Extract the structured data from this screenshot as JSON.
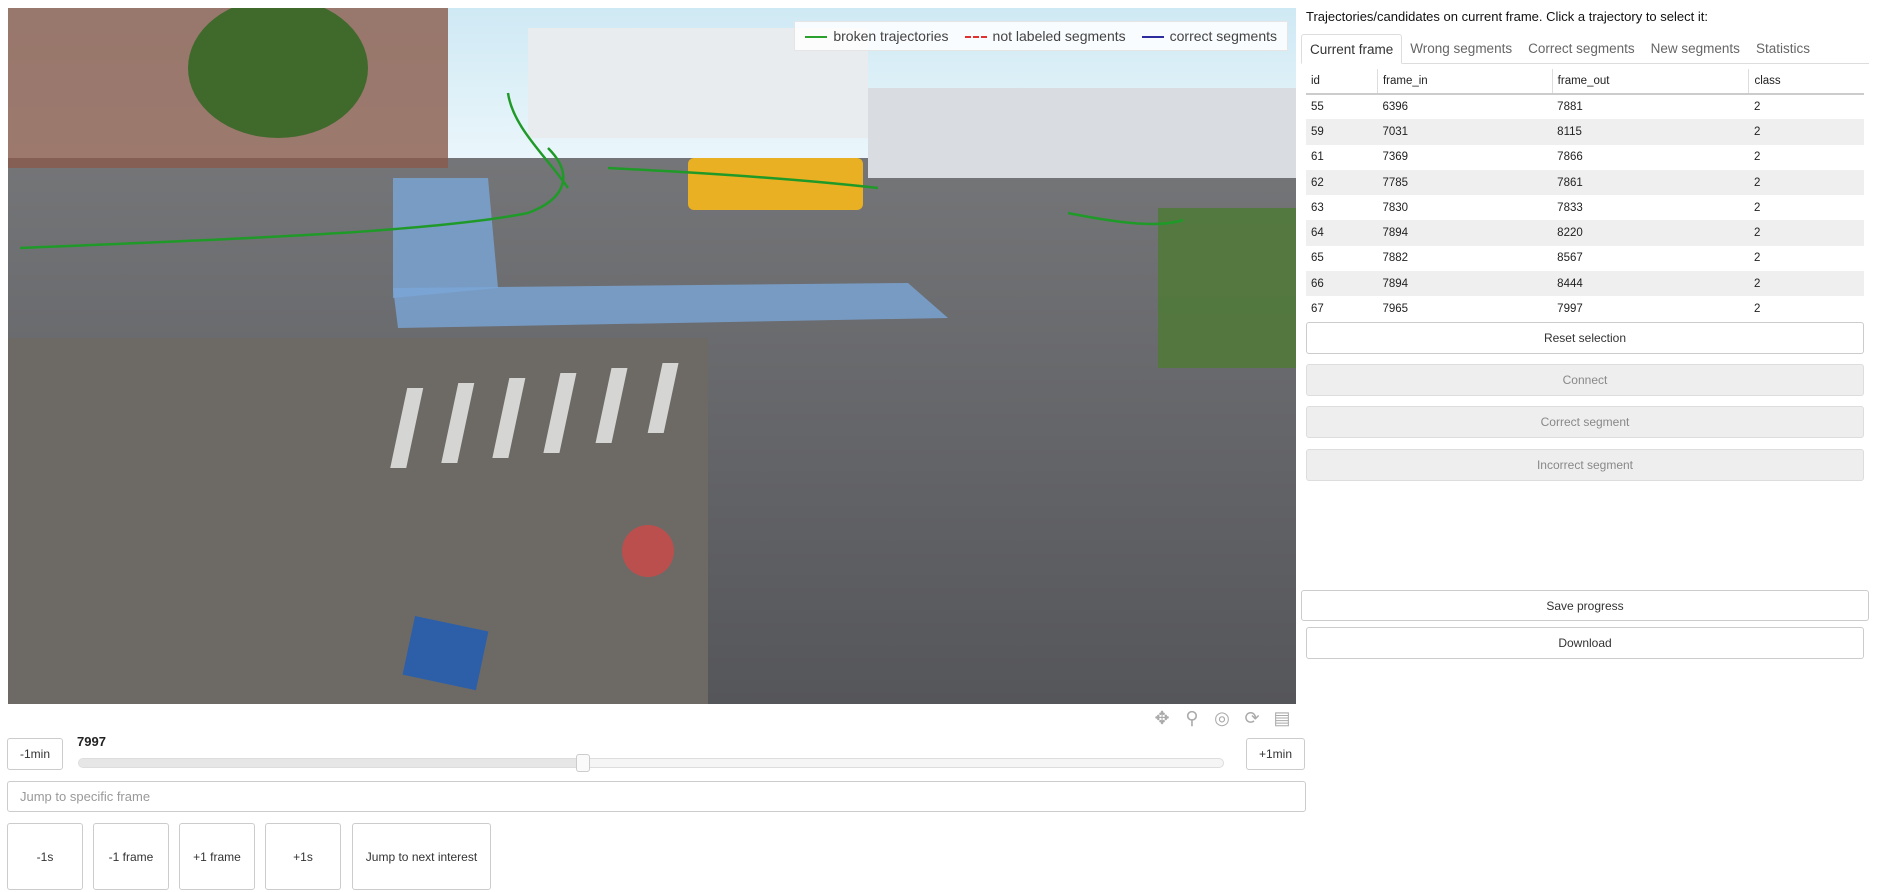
{
  "video": {
    "legend": [
      {
        "label": "broken trajectories",
        "color": "#2ca02c",
        "style": "solid"
      },
      {
        "label": "not labeled segments",
        "color": "#e03030",
        "style": "dashed"
      },
      {
        "label": "correct segments",
        "color": "#2c2c9c",
        "style": "solid"
      }
    ],
    "toolbar": [
      "pan-icon",
      "box-zoom-icon",
      "wheel-zoom-icon",
      "reset-icon",
      "hover-icon"
    ]
  },
  "controls": {
    "minus_min": "-1min",
    "plus_min": "+1min",
    "frame_value": "7997",
    "slider_fraction": 0.44,
    "jump_placeholder": "Jump to specific frame",
    "minus_1s": "-1s",
    "minus_frame": "-1 frame",
    "plus_frame": "+1 frame",
    "plus_1s": "+1s",
    "next_interest": "Jump to next interest"
  },
  "panel": {
    "title": "Trajectories/candidates on current frame. Click a trajectory to select it:",
    "tabs": [
      "Current frame",
      "Wrong segments",
      "Correct segments",
      "New segments",
      "Statistics"
    ],
    "columns": [
      "id",
      "frame_in",
      "frame_out",
      "class"
    ],
    "rows": [
      [
        "55",
        "6396",
        "7881",
        "2"
      ],
      [
        "59",
        "7031",
        "8115",
        "2"
      ],
      [
        "61",
        "7369",
        "7866",
        "2"
      ],
      [
        "62",
        "7785",
        "7861",
        "2"
      ],
      [
        "63",
        "7830",
        "7833",
        "2"
      ],
      [
        "64",
        "7894",
        "8220",
        "2"
      ],
      [
        "65",
        "7882",
        "8567",
        "2"
      ],
      [
        "66",
        "7894",
        "8444",
        "2"
      ],
      [
        "67",
        "7965",
        "7997",
        "2"
      ]
    ],
    "reset": "Reset selection",
    "connect": "Connect",
    "correct": "Correct segment",
    "incorrect": "Incorrect segment",
    "save": "Save progress",
    "download": "Download"
  }
}
